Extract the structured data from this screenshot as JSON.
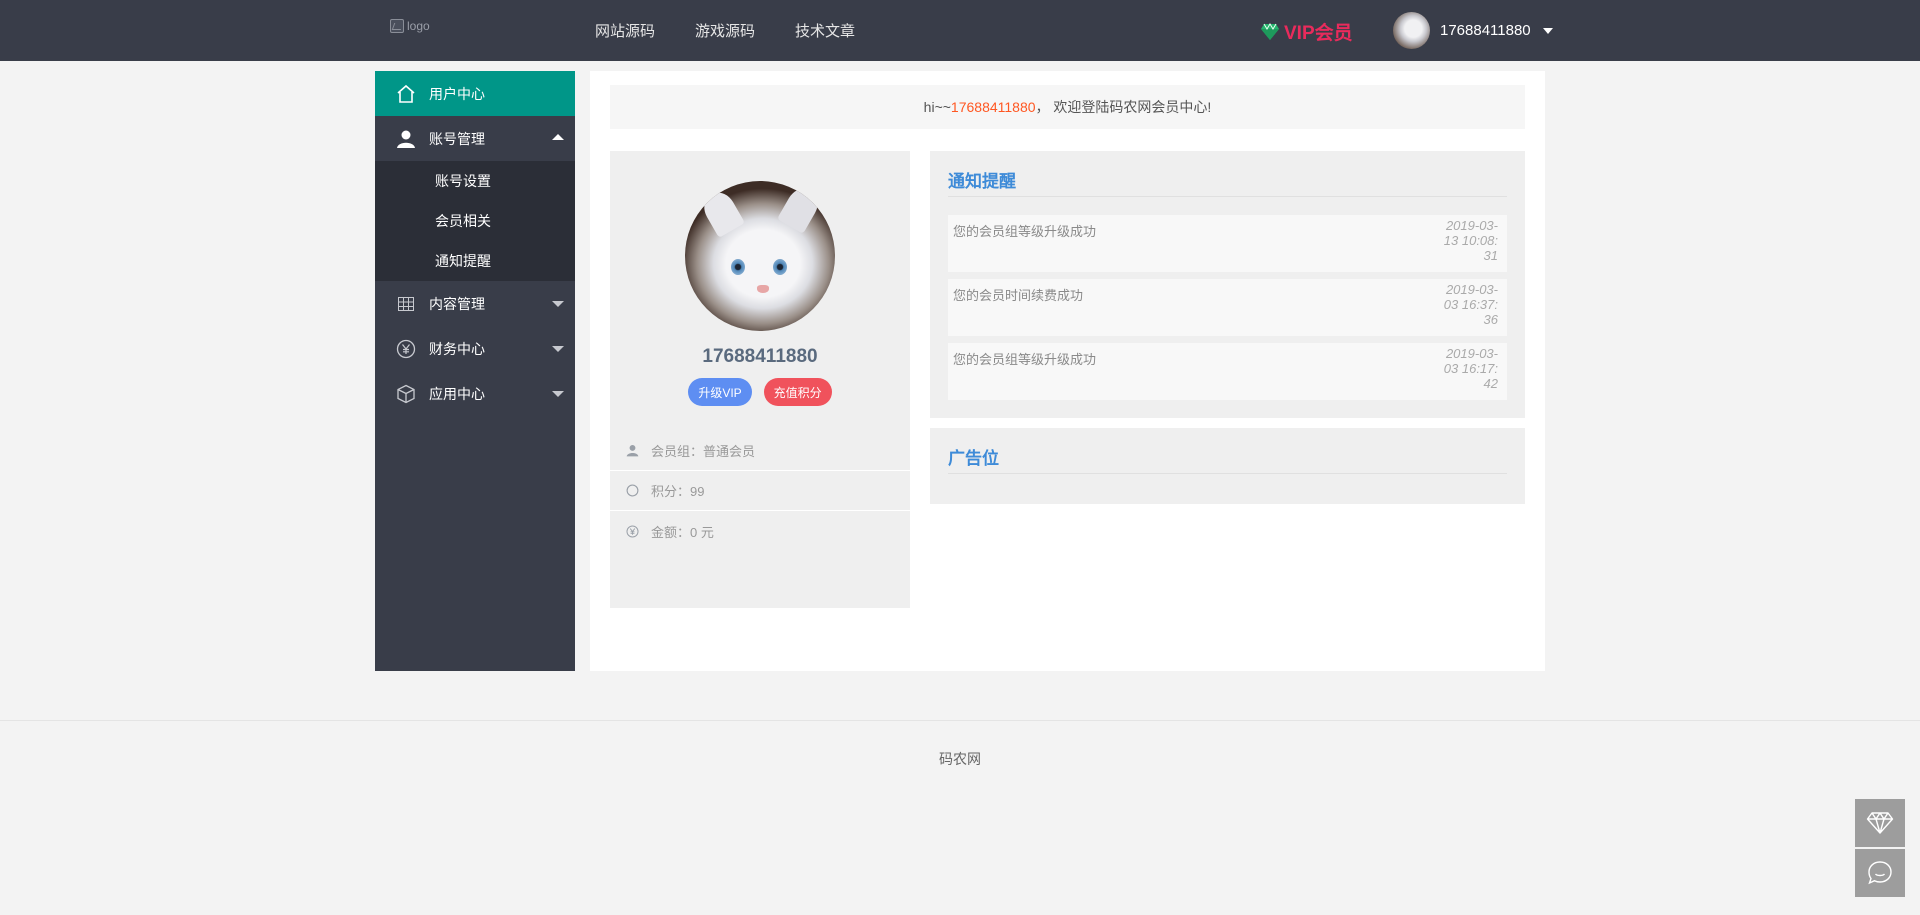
{
  "header": {
    "logo_alt": "logo",
    "nav": [
      "网站源码",
      "游戏源码",
      "技术文章"
    ],
    "vip_label": "VIP会员",
    "username": "17688411880"
  },
  "sidebar": {
    "items": [
      {
        "label": "用户中心",
        "icon": "home-icon",
        "state": "active"
      },
      {
        "label": "账号管理",
        "icon": "user-icon",
        "state": "open",
        "children": [
          "账号设置",
          "会员相关",
          "通知提醒"
        ]
      },
      {
        "label": "内容管理",
        "icon": "grid-icon",
        "state": "collapsed"
      },
      {
        "label": "财务中心",
        "icon": "yen-circle-icon",
        "state": "collapsed"
      },
      {
        "label": "应用中心",
        "icon": "cube-icon",
        "state": "collapsed"
      }
    ]
  },
  "welcome": {
    "prefix": "hi~~ ",
    "phone": "17688411880",
    "suffix": "， 欢迎登陆码农网会员中心!"
  },
  "profile": {
    "username": "17688411880",
    "upgrade_btn": "升级VIP",
    "recharge_btn": "充值积分",
    "rows": [
      {
        "icon": "user-icon",
        "text": "会员组：普通会员"
      },
      {
        "icon": "circle-icon",
        "text": "积分：99"
      },
      {
        "icon": "yen-circle-icon",
        "text": "金额：0 元"
      }
    ]
  },
  "notify": {
    "title": "通知提醒",
    "items": [
      {
        "msg": "您的会员组等级升级成功",
        "time": "2019-03-13 10:08:31"
      },
      {
        "msg": "您的会员时间续费成功",
        "time": "2019-03-03 16:37:36"
      },
      {
        "msg": "您的会员组等级升级成功",
        "time": "2019-03-03 16:17:42"
      }
    ]
  },
  "ad": {
    "title": "广告位"
  },
  "footer": {
    "copyright": "码农网"
  },
  "colors": {
    "topbar": "#393d49",
    "active": "#009688",
    "vip": "#e92b5c",
    "title": "#3e8bd8",
    "phone": "#ff5722"
  }
}
